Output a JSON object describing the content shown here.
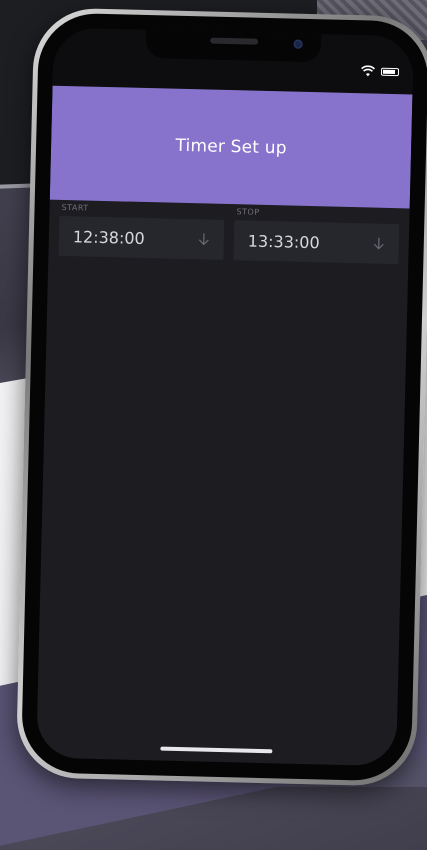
{
  "header": {
    "title": "Timer Set up",
    "color": "#8873cc"
  },
  "start": {
    "label": "START",
    "value": "12:38:00",
    "icon": "down-arrow-icon"
  },
  "stop": {
    "label": "STOP",
    "value": "13:33:00",
    "icon": "down-arrow-icon"
  },
  "status_bar": {
    "icons": [
      "wifi-icon",
      "battery-icon"
    ]
  },
  "colors": {
    "screen_bg": "#1c1c21",
    "field_bg": "#26272c"
  }
}
